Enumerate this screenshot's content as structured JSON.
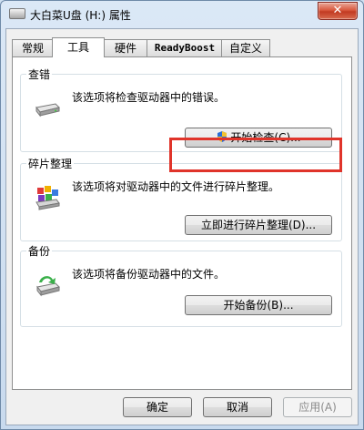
{
  "window": {
    "title": "大白菜U盘 (H:) 属性",
    "close_label": "✕"
  },
  "tabs": [
    {
      "label": "常规"
    },
    {
      "label": "工具"
    },
    {
      "label": "硬件"
    },
    {
      "label": "ReadyBoost"
    },
    {
      "label": "自定义"
    }
  ],
  "groups": {
    "check": {
      "title": "查错",
      "description": "该选项将检查驱动器中的错误。",
      "button": "开始检查(C)...",
      "icon": "drive-icon"
    },
    "defrag": {
      "title": "碎片整理",
      "description": "该选项将对驱动器中的文件进行碎片整理。",
      "button": "立即进行碎片整理(D)...",
      "icon": "defrag-icon"
    },
    "backup": {
      "title": "备份",
      "description": "该选项将备份驱动器中的文件。",
      "button": "开始备份(B)...",
      "icon": "backup-icon"
    }
  },
  "footer": {
    "ok": "确定",
    "cancel": "取消",
    "apply": "应用(A)"
  },
  "colors": {
    "highlight": "#e0342a",
    "title_bar": "#dbe8f6"
  }
}
